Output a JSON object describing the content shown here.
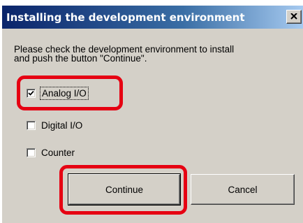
{
  "window": {
    "title": "Installing the development environment"
  },
  "instructions": {
    "line1": "Please check the development environment to install",
    "line2": "and push the button \"Continue\"."
  },
  "options": [
    {
      "label": "Analog I/O",
      "checked": true
    },
    {
      "label": "Digital I/O",
      "checked": false
    },
    {
      "label": "Counter",
      "checked": false
    }
  ],
  "buttons": {
    "continue_label": "Continue",
    "cancel_label": "Cancel"
  },
  "colors": {
    "annotation_red": "#e60012",
    "dialog_face": "#d4d0c8",
    "title_gradient_start": "#0a246a"
  }
}
